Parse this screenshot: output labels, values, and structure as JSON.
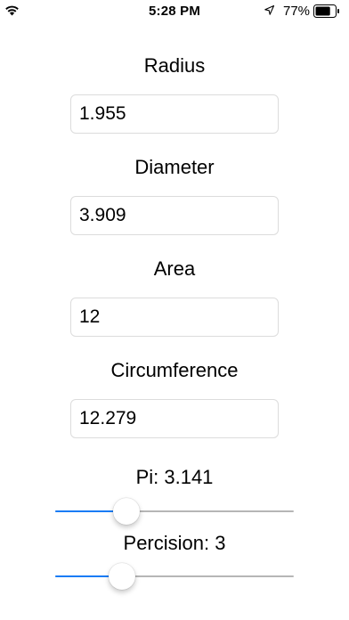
{
  "status_bar": {
    "time": "5:28 PM",
    "battery_percent": "77%",
    "battery_level": 0.77,
    "icons": [
      "wifi-icon",
      "location-arrow-icon",
      "battery-icon"
    ]
  },
  "radius": {
    "label": "Radius",
    "value": "1.955"
  },
  "diameter": {
    "label": "Diameter",
    "value": "3.909"
  },
  "area": {
    "label": "Area",
    "value": "12"
  },
  "circumference": {
    "label": "Circumference",
    "value": "12.279"
  },
  "pi": {
    "label": "Pi: 3.141",
    "slider_fraction": 0.3
  },
  "precision": {
    "label": "Percision: 3",
    "slider_fraction": 0.28
  },
  "colors": {
    "accent": "#1a7cf5",
    "track": "#b6b6b6",
    "field_border": "#dcdcdc"
  }
}
